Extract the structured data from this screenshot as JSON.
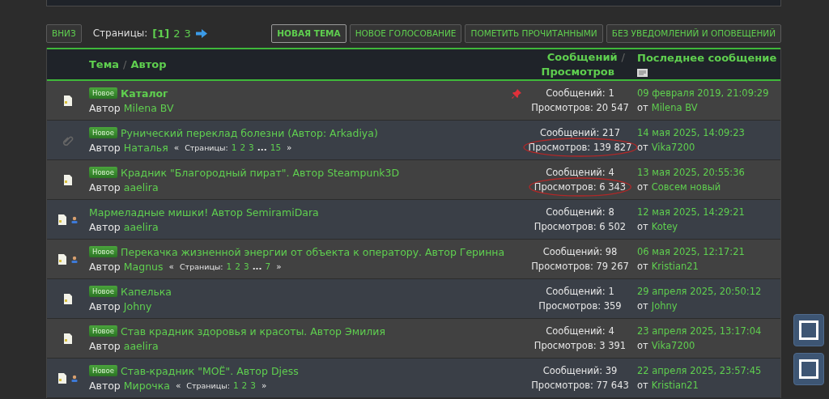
{
  "toolbar": {
    "down_button": "ВНИЗ",
    "pages_label": "Страницы:",
    "pages": [
      {
        "label": "[1]",
        "selected": true
      },
      {
        "label": "2",
        "selected": false
      },
      {
        "label": "3",
        "selected": false
      }
    ],
    "buttons": [
      {
        "label": "НОВАЯ ТЕМА",
        "highlighted": true
      },
      {
        "label": "НОВОЕ ГОЛОСОВАНИЕ",
        "highlighted": false
      },
      {
        "label": "ПОМЕТИТЬ ПРОЧИТАННЫМИ",
        "highlighted": false
      },
      {
        "label": "БЕЗ УВЕДОМЛЕНИЙ И ОПОВЕЩЕНИЙ",
        "highlighted": false
      }
    ]
  },
  "header": {
    "topic": "Тема",
    "separator": "/",
    "author": "Автор",
    "replies": "Сообщений",
    "views": "Просмотров",
    "last_post": "Последнее сообщение"
  },
  "rows": [
    {
      "icons": [
        {
          "kind": "file"
        }
      ],
      "badge": "Новое",
      "title": "Каталог",
      "bold": true,
      "pinned": true,
      "author_label": "Автор",
      "author": "Milena BV",
      "replies": "Сообщений: 1",
      "views": "Просмотров: 20 547",
      "circled": false,
      "last_date": "09 февраля 2019, 21:09:29",
      "last_from": "от",
      "last_author": "Milena BV"
    },
    {
      "icons": [
        {
          "kind": "clip"
        }
      ],
      "badge": "Новое",
      "title": "Рунический переклад болезни (Автор: Arkadiya)",
      "bold": false,
      "pinned": false,
      "author_label": "Автор",
      "author": "Наталья",
      "pages": [
        {
          "kind": "mark",
          "text": "«"
        },
        {
          "kind": "label",
          "text": "Страницы:"
        },
        {
          "kind": "link",
          "text": "1"
        },
        {
          "kind": "link",
          "text": "2"
        },
        {
          "kind": "link",
          "text": "3"
        },
        {
          "kind": "gap",
          "text": "..."
        },
        {
          "kind": "link",
          "text": "15"
        },
        {
          "kind": "mark",
          "text": "»"
        }
      ],
      "replies": "Сообщений: 217",
      "views": "Просмотров: 139 827",
      "circled": true,
      "last_date": "14 мая 2025, 14:09:23",
      "last_from": "от",
      "last_author": "Vika7200"
    },
    {
      "icons": [
        {
          "kind": "file"
        }
      ],
      "badge": "Новое",
      "title": "Крадник \"Благородный пират\". Автор Steampunk3D",
      "bold": false,
      "pinned": false,
      "author_label": "Автор",
      "author": "aaelira",
      "replies": "Сообщений: 4",
      "views": "Просмотров: 6 343",
      "circled": true,
      "last_date": "13 мая 2025, 20:55:36",
      "last_from": "от",
      "last_author": "Совсем новый"
    },
    {
      "icons": [
        {
          "kind": "file"
        },
        {
          "kind": "person"
        }
      ],
      "title": "Мармеладные мишки! Автор SemiramiDara",
      "bold": false,
      "pinned": false,
      "author_label": "Автор",
      "author": "aaelira",
      "replies": "Сообщений: 8",
      "views": "Просмотров: 6 502",
      "circled": false,
      "last_date": "12 мая 2025, 14:29:21",
      "last_from": "от",
      "last_author": "Kotey"
    },
    {
      "icons": [
        {
          "kind": "file"
        },
        {
          "kind": "person"
        }
      ],
      "badge": "Новое",
      "title": "Перекачка жизненной энергии от объекта к оператору. Автор Геринна",
      "bold": false,
      "pinned": false,
      "author_label": "Автор",
      "author": "Magnus",
      "pages": [
        {
          "kind": "mark",
          "text": "«"
        },
        {
          "kind": "label",
          "text": "Страницы:"
        },
        {
          "kind": "link",
          "text": "1"
        },
        {
          "kind": "link",
          "text": "2"
        },
        {
          "kind": "link",
          "text": "3"
        },
        {
          "kind": "gap",
          "text": "..."
        },
        {
          "kind": "link",
          "text": "7"
        },
        {
          "kind": "mark",
          "text": "»"
        }
      ],
      "replies": "Сообщений: 98",
      "views": "Просмотров: 79 267",
      "circled": false,
      "last_date": "06 мая 2025, 12:17:21",
      "last_from": "от",
      "last_author": "Kristian21"
    },
    {
      "icons": [
        {
          "kind": "file"
        }
      ],
      "badge": "Новое",
      "title": "Капелька",
      "bold": false,
      "pinned": false,
      "author_label": "Автор",
      "author": "Johny",
      "replies": "Сообщений: 1",
      "views": "Просмотров: 359",
      "circled": false,
      "last_date": "29 апреля 2025, 20:50:12",
      "last_from": "от",
      "last_author": "Johny"
    },
    {
      "icons": [
        {
          "kind": "file"
        }
      ],
      "badge": "Новое",
      "title": "Став крадник здоровья и красоты. Автор Эмилия",
      "bold": false,
      "pinned": false,
      "author_label": "Автор",
      "author": "aaelira",
      "replies": "Сообщений: 4",
      "views": "Просмотров: 3 391",
      "circled": false,
      "last_date": "23 апреля 2025, 13:17:04",
      "last_from": "от",
      "last_author": "Vika7200"
    },
    {
      "icons": [
        {
          "kind": "file"
        },
        {
          "kind": "person"
        }
      ],
      "badge": "Новое",
      "title": "Став-крадник \"МОЁ\". Автор Djess",
      "bold": false,
      "pinned": false,
      "author_label": "Автор",
      "author": "Мирочка",
      "pages": [
        {
          "kind": "mark",
          "text": "«"
        },
        {
          "kind": "label",
          "text": "Страницы:"
        },
        {
          "kind": "link",
          "text": "1"
        },
        {
          "kind": "link",
          "text": "2"
        },
        {
          "kind": "link",
          "text": "3"
        },
        {
          "kind": "mark",
          "text": "»"
        }
      ],
      "replies": "Сообщений: 39",
      "views": "Просмотров: 77 643",
      "circled": false,
      "last_date": "22 апреля 2025, 23:57:45",
      "last_from": "от",
      "last_author": "Kristian21"
    }
  ],
  "side_buttons": [
    {
      "kind": "square"
    },
    {
      "kind": "square"
    }
  ]
}
